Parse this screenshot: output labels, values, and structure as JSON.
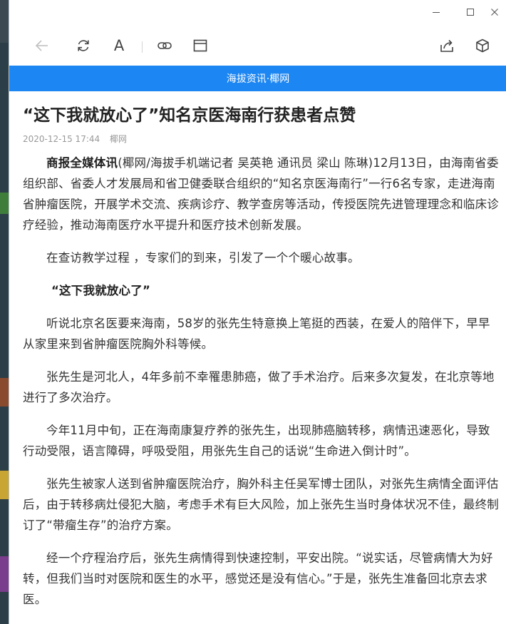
{
  "window": {
    "minimize_label": "Minimize",
    "maximize_label": "Maximize",
    "close_label": "Close"
  },
  "toolbar": {
    "back": "back-icon",
    "refresh": "refresh-icon",
    "font": "A",
    "link": "link-icon",
    "window": "window-icon",
    "share": "share-icon",
    "cube": "cube-icon"
  },
  "banner": {
    "text": "海拔资讯·椰网"
  },
  "colors": {
    "banner": "#1c86f2",
    "desktop": "#2c3e47"
  },
  "article": {
    "title": "“这下我就放心了”知名京医海南行获患者点赞",
    "date": "2020-12-15 17:44",
    "source": "椰网",
    "lead_bold": "商报全媒体讯",
    "p1": "(椰网/海拔手机端记者 吴英艳 通讯员 梁山 陈琳)12月13日，由海南省委组织部、省委人才发展局和省卫健委联合组织的“知名京医海南行”一行6名专家，走进海南省肿瘤医院，开展学术交流、疾病诊疗、教学查房等活动，传授医院先进管理理念和临床诊疗经验，推动海南医疗水平提升和医疗技术创新发展。",
    "p2": "在查访教学过程 ，专家们的到来，引发了一个个暖心故事。",
    "subtitle": "“这下我就放心了”",
    "p3": "听说北京名医要来海南，58岁的张先生特意换上笔挺的西装，在爱人的陪伴下，早早从家里来到省肿瘤医院胸外科等候。",
    "p4": "张先生是河北人，4年多前不幸罹患肺癌，做了手术治疗。后来多次复发，在北京等地进行了多次治疗。",
    "p5": "今年11月中旬，正在海南康复疗养的张先生，出现肺癌脑转移，病情迅速恶化，导致行动受限，语言障碍，呼吸受阻，用张先生自己的话说“生命进入倒计时”。",
    "p6": "张先生被家人送到省肿瘤医院治疗，胸外科主任吴军博士团队，对张先生病情全面评估后，由于转移病灶侵犯大脑，考虑手术有巨大风险，加上张先生当时身体状况不佳，最终制订了“带瘤生存”的治疗方案。",
    "p7": "经一个疗程治疗后，张先生病情得到快速控制，平安出院。“说实话，尽管病情大为好转，但我们当时对医院和医生的水平，感觉还是没有信心。”于是，张先生准备回北京去求医。"
  }
}
